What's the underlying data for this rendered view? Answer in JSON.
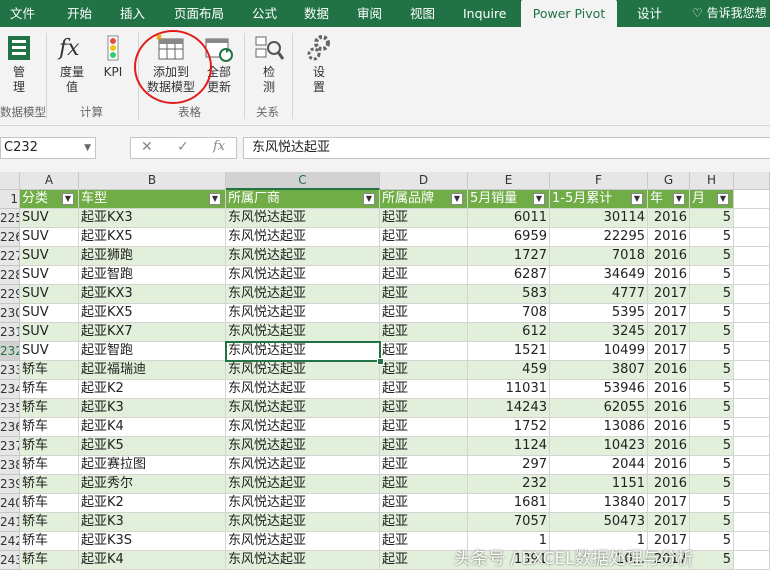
{
  "tabs": [
    "文件",
    "开始",
    "插入",
    "页面布局",
    "公式",
    "数据",
    "审阅",
    "视图",
    "Inquire",
    "Power Pivot",
    "设计"
  ],
  "active_tab": "Power Pivot",
  "tell_me": "告诉我您想",
  "ribbon": {
    "manage": "管\n理",
    "measures": "度量\n值",
    "kpi": "KPI",
    "add_to_model": "添加到\n数据模型",
    "update_all": "全部\n更新",
    "detect": "检\n测",
    "settings": "设\n置",
    "groups": [
      "数据模型",
      "计算",
      "表格",
      "关系"
    ]
  },
  "name_box": "C232",
  "formula_value": "东风悦达起亚",
  "columns": [
    "A",
    "B",
    "C",
    "D",
    "E",
    "F",
    "G",
    "H"
  ],
  "header_row_number": "1",
  "headers": [
    "分类",
    "车型",
    "所属厂商",
    "所属品牌",
    "5月销量",
    "1-5月累计",
    "年",
    "月"
  ],
  "rows": [
    {
      "n": "225",
      "a": "SUV",
      "b": "起亚KX3",
      "c": "东风悦达起亚",
      "d": "起亚",
      "e": "6011",
      "f": "30114",
      "g": "2016",
      "h": "5"
    },
    {
      "n": "226",
      "a": "SUV",
      "b": "起亚KX5",
      "c": "东风悦达起亚",
      "d": "起亚",
      "e": "6959",
      "f": "22295",
      "g": "2016",
      "h": "5"
    },
    {
      "n": "227",
      "a": "SUV",
      "b": "起亚狮跑",
      "c": "东风悦达起亚",
      "d": "起亚",
      "e": "1727",
      "f": "7018",
      "g": "2016",
      "h": "5"
    },
    {
      "n": "228",
      "a": "SUV",
      "b": "起亚智跑",
      "c": "东风悦达起亚",
      "d": "起亚",
      "e": "6287",
      "f": "34649",
      "g": "2016",
      "h": "5"
    },
    {
      "n": "229",
      "a": "SUV",
      "b": "起亚KX3",
      "c": "东风悦达起亚",
      "d": "起亚",
      "e": "583",
      "f": "4777",
      "g": "2017",
      "h": "5"
    },
    {
      "n": "230",
      "a": "SUV",
      "b": "起亚KX5",
      "c": "东风悦达起亚",
      "d": "起亚",
      "e": "708",
      "f": "5395",
      "g": "2017",
      "h": "5"
    },
    {
      "n": "231",
      "a": "SUV",
      "b": "起亚KX7",
      "c": "东风悦达起亚",
      "d": "起亚",
      "e": "612",
      "f": "3245",
      "g": "2017",
      "h": "5"
    },
    {
      "n": "232",
      "a": "SUV",
      "b": "起亚智跑",
      "c": "东风悦达起亚",
      "d": "起亚",
      "e": "1521",
      "f": "10499",
      "g": "2017",
      "h": "5"
    },
    {
      "n": "233",
      "a": "轿车",
      "b": "起亚福瑞迪",
      "c": "东风悦达起亚",
      "d": "起亚",
      "e": "459",
      "f": "3807",
      "g": "2016",
      "h": "5"
    },
    {
      "n": "234",
      "a": "轿车",
      "b": "起亚K2",
      "c": "东风悦达起亚",
      "d": "起亚",
      "e": "11031",
      "f": "53946",
      "g": "2016",
      "h": "5"
    },
    {
      "n": "235",
      "a": "轿车",
      "b": "起亚K3",
      "c": "东风悦达起亚",
      "d": "起亚",
      "e": "14243",
      "f": "62055",
      "g": "2016",
      "h": "5"
    },
    {
      "n": "236",
      "a": "轿车",
      "b": "起亚K4",
      "c": "东风悦达起亚",
      "d": "起亚",
      "e": "1752",
      "f": "13086",
      "g": "2016",
      "h": "5"
    },
    {
      "n": "237",
      "a": "轿车",
      "b": "起亚K5",
      "c": "东风悦达起亚",
      "d": "起亚",
      "e": "1124",
      "f": "10423",
      "g": "2016",
      "h": "5"
    },
    {
      "n": "238",
      "a": "轿车",
      "b": "起亚赛拉图",
      "c": "东风悦达起亚",
      "d": "起亚",
      "e": "297",
      "f": "2044",
      "g": "2016",
      "h": "5"
    },
    {
      "n": "239",
      "a": "轿车",
      "b": "起亚秀尔",
      "c": "东风悦达起亚",
      "d": "起亚",
      "e": "232",
      "f": "1151",
      "g": "2016",
      "h": "5"
    },
    {
      "n": "240",
      "a": "轿车",
      "b": "起亚K2",
      "c": "东风悦达起亚",
      "d": "起亚",
      "e": "1681",
      "f": "13840",
      "g": "2017",
      "h": "5"
    },
    {
      "n": "241",
      "a": "轿车",
      "b": "起亚K3",
      "c": "东风悦达起亚",
      "d": "起亚",
      "e": "7057",
      "f": "50473",
      "g": "2017",
      "h": "5"
    },
    {
      "n": "242",
      "a": "轿车",
      "b": "起亚K3S",
      "c": "东风悦达起亚",
      "d": "起亚",
      "e": "1",
      "f": "1",
      "g": "2017",
      "h": "5"
    },
    {
      "n": "243",
      "a": "轿车",
      "b": "起亚K4",
      "c": "东风悦达起亚",
      "d": "起亚",
      "e": "1391",
      "f": "10...",
      "g": "2017",
      "h": "5"
    }
  ],
  "selected_row": "232",
  "selected_col": "C",
  "watermark": "头条号 / EXCEL数据处理与分析",
  "colors": {
    "green": "#217346",
    "header_fill": "#70ad47",
    "band_fill": "#e2efda",
    "tab_text": "#ffffff"
  }
}
